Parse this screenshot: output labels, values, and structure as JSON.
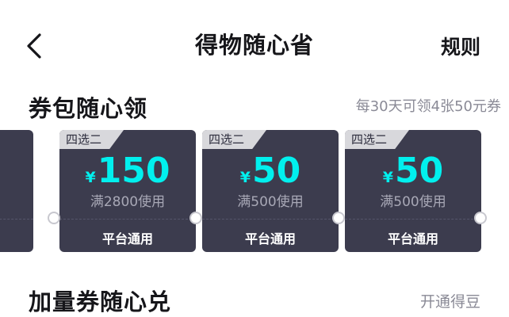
{
  "header": {
    "title": "得物随心省",
    "rules_label": "规则"
  },
  "section_coupons": {
    "title": "券包随心领",
    "subtitle": "每30天可领4张50元券"
  },
  "coupons": [
    {
      "tag": "四选二",
      "currency": "¥",
      "amount": "150",
      "condition": "满2800使用",
      "usage": "平台通用"
    },
    {
      "tag": "四选二",
      "currency": "¥",
      "amount": "50",
      "condition": "满500使用",
      "usage": "平台通用"
    },
    {
      "tag": "四选二",
      "currency": "¥",
      "amount": "50",
      "condition": "满500使用",
      "usage": "平台通用"
    }
  ],
  "section_extra": {
    "title": "加量券随心兑",
    "link_label": "开通得豆"
  },
  "colors": {
    "coupon_bg": "#3c3c4e",
    "amount": "#01f0ee",
    "tag_bg": "#d8d8dc"
  }
}
